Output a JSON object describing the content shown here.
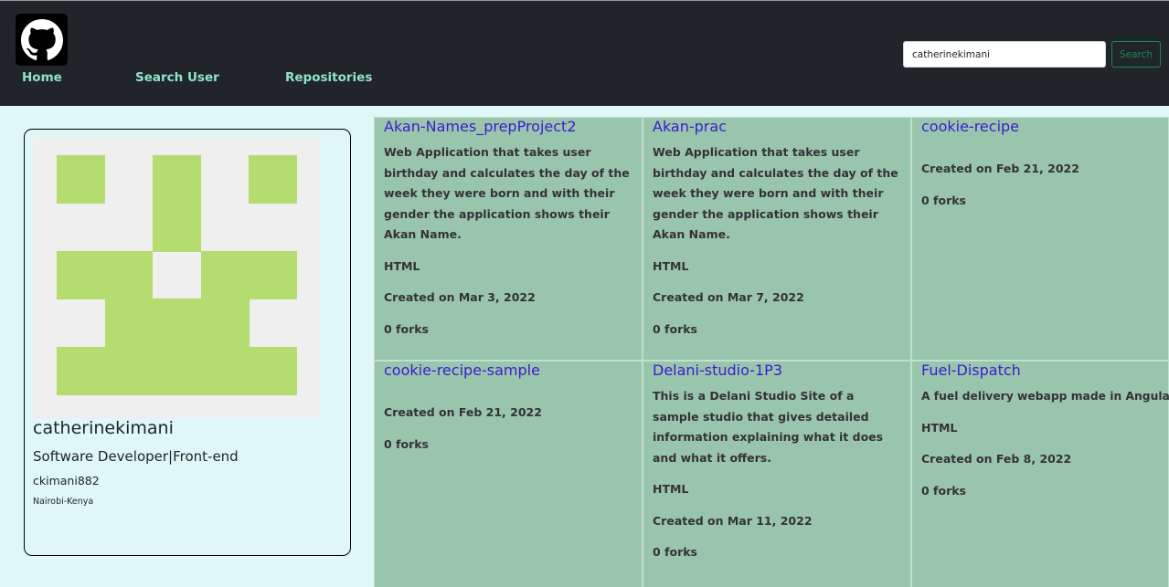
{
  "nav": {
    "home": "Home",
    "search_user": "Search User",
    "repositories": "Repositories",
    "search_value": "catherinekimani",
    "search_button": "Search",
    "logo_icon": "github-icon"
  },
  "profile": {
    "name": "catherinekimani",
    "bio": "Software Developer|Front-end",
    "login": "ckimani882",
    "location": "Nairobi-Kenya",
    "avatar_color": "#b4dc6e",
    "avatar_bg": "#efefef"
  },
  "repos": [
    {
      "name": "Akan-Names_prepProject2",
      "description": "Web Application that takes user birthday and calculates the day of the week they were born and with their gender the application shows their Akan Name.",
      "language": "HTML",
      "created": "Created on Mar 3, 2022",
      "forks": "0 forks"
    },
    {
      "name": "Akan-prac",
      "description": "Web Application that takes user birthday and calculates the day of the week they were born and with their gender the application shows their Akan Name.",
      "language": "HTML",
      "created": "Created on Mar 7, 2022",
      "forks": "0 forks"
    },
    {
      "name": "cookie-recipe",
      "description": "",
      "language": "",
      "created": "Created on Feb 21, 2022",
      "forks": "0 forks"
    },
    {
      "name": "cookie-recipe-sample",
      "description": "",
      "language": "",
      "created": "Created on Feb 21, 2022",
      "forks": "0 forks"
    },
    {
      "name": "Delani-studio-1P3",
      "description": "This is a Delani Studio Site of a sample studio that gives detailed information explaining what it does and what it offers.",
      "language": "HTML",
      "created": "Created on Mar 11, 2022",
      "forks": "0 forks"
    },
    {
      "name": "Fuel-Dispatch",
      "description": "A fuel delivery webapp made in Angular.",
      "language": "HTML",
      "created": "Created on Feb 8, 2022",
      "forks": "0 forks"
    }
  ],
  "colors": {
    "navbar": "#212529",
    "nav_link": "#8fe3c8",
    "page_bg": "#dff7f7",
    "card_bg": "#9ac5ad",
    "repo_link": "#3b1ccf",
    "search_button": "#198754"
  }
}
